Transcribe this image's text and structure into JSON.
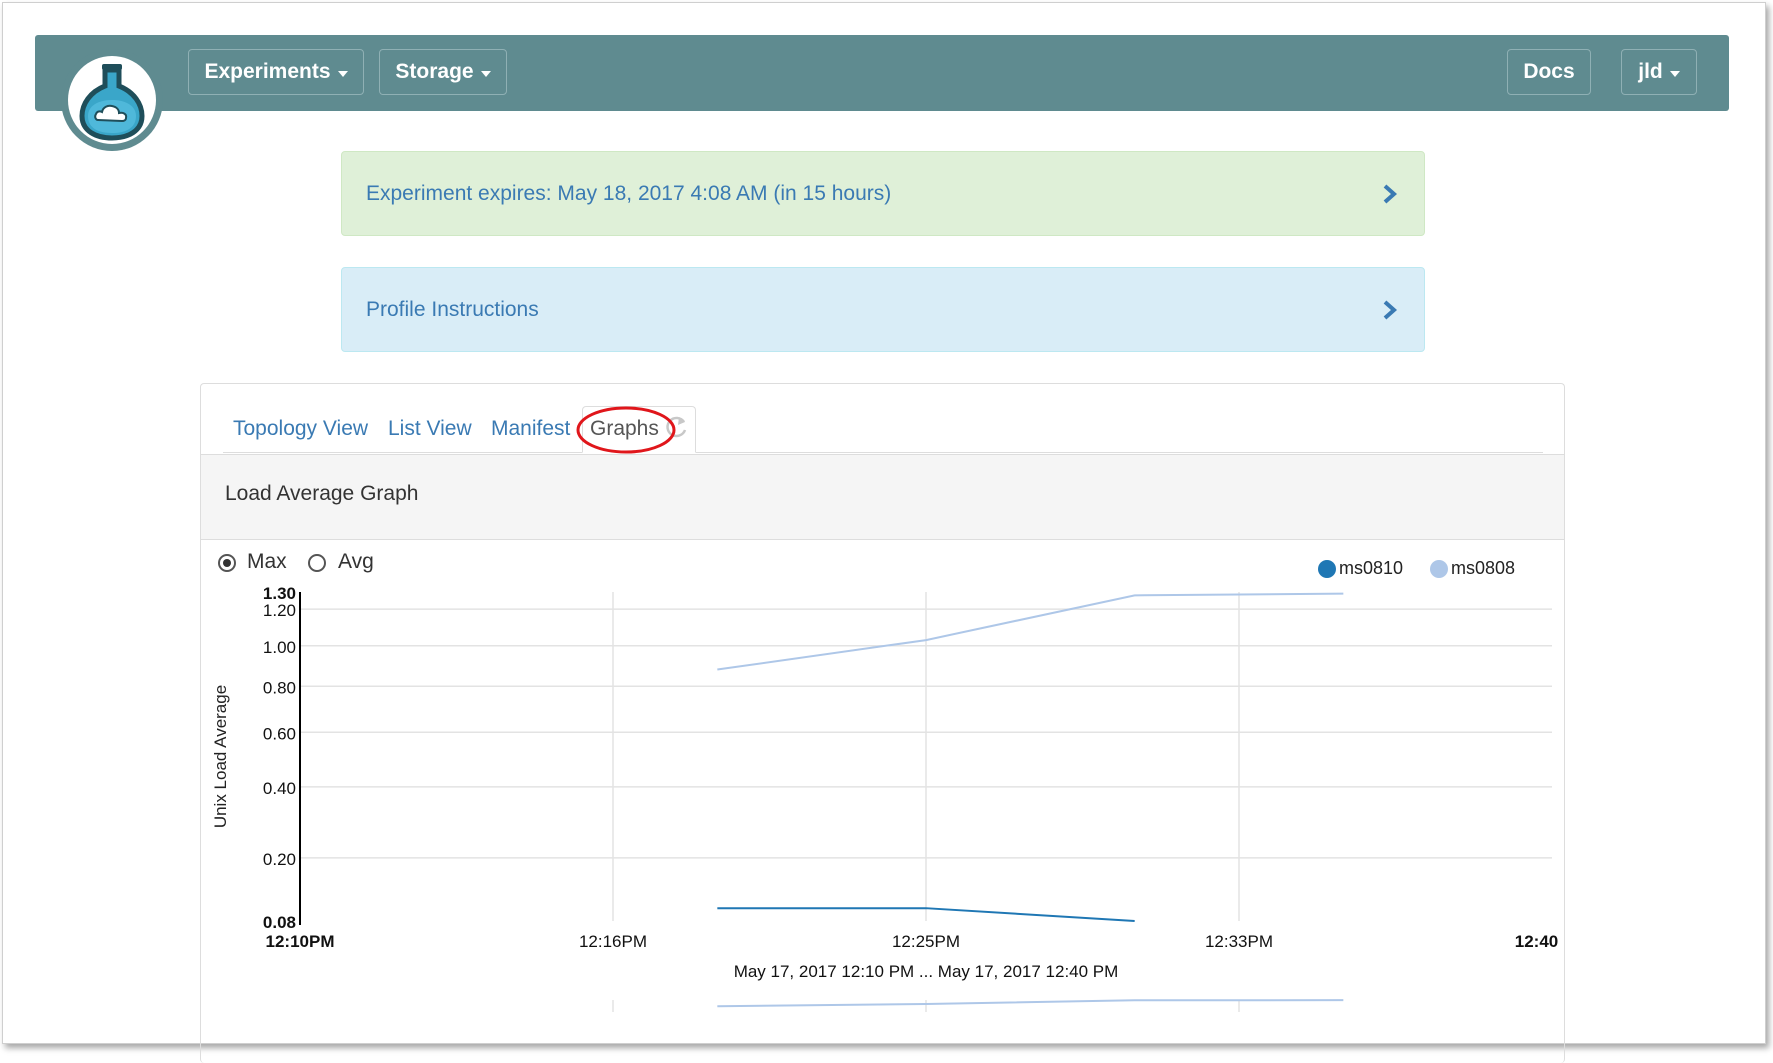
{
  "navbar": {
    "experiments_label": "Experiments",
    "storage_label": "Storage",
    "docs_label": "Docs",
    "user_label": "jld",
    "color": "#5f8b90"
  },
  "alerts": {
    "expires_text": "Experiment expires: May 18, 2017 4:08 AM (in 15 hours)",
    "instructions_text": "Profile Instructions"
  },
  "tabs": [
    {
      "label": "Topology View"
    },
    {
      "label": "List View"
    },
    {
      "label": "Manifest"
    },
    {
      "label": "Graphs",
      "active": true
    }
  ],
  "graph": {
    "title": "Load Average Graph",
    "options": [
      {
        "label": "Max",
        "selected": true
      },
      {
        "label": "Avg",
        "selected": false
      }
    ]
  },
  "chart_data": {
    "type": "line",
    "ylabel": "Unix Load Average",
    "xlabel": "May 17, 2017 12:10 PM ... May 17, 2017 12:40 PM",
    "y_scale": "sqrt",
    "ylim": [
      0.08,
      1.3
    ],
    "yticks": [
      "1.30",
      "1.20",
      "1.00",
      "0.80",
      "0.60",
      "0.40",
      "0.20",
      "0.08"
    ],
    "xticks": [
      "12:10PM",
      "12:16PM",
      "12:25PM",
      "12:33PM",
      "12:40"
    ],
    "xlim": [
      "12:10",
      "12:40"
    ],
    "grid": true,
    "legend": "top-right",
    "series": [
      {
        "name": "ms0810",
        "color": "#1f77b4",
        "x": [
          "12:20",
          "12:25",
          "12:30"
        ],
        "y": [
          0.1,
          0.1,
          0.08
        ]
      },
      {
        "name": "ms0808",
        "color": "#aec7e8",
        "x": [
          "12:20",
          "12:25",
          "12:30",
          "12:35"
        ],
        "y": [
          0.88,
          1.03,
          1.28,
          1.29
        ]
      }
    ]
  }
}
